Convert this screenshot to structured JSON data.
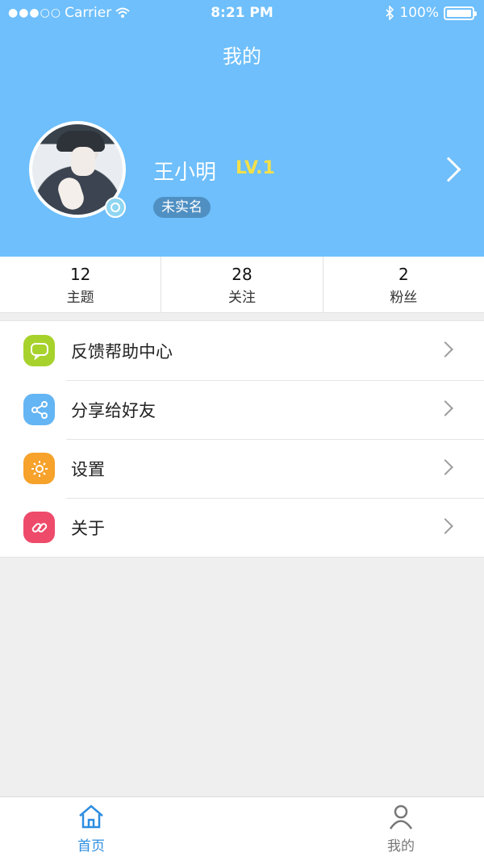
{
  "status_bar": {
    "carrier": "Carrier",
    "time": "8:21 PM",
    "battery": "100%"
  },
  "nav": {
    "title": "我的"
  },
  "profile": {
    "name": "王小明",
    "level": "LV.1",
    "verify_status": "未实名"
  },
  "stats": [
    {
      "value": "12",
      "label": "主题"
    },
    {
      "value": "28",
      "label": "关注"
    },
    {
      "value": "2",
      "label": "粉丝"
    }
  ],
  "menu": [
    {
      "label": "反馈帮助中心",
      "icon": "chat-bubble-icon",
      "color": "#a7d22c"
    },
    {
      "label": "分享给好友",
      "icon": "share-icon",
      "color": "#64b5f4"
    },
    {
      "label": "设置",
      "icon": "gear-icon",
      "color": "#f6a22b"
    },
    {
      "label": "关于",
      "icon": "link-icon",
      "color": "#ee4b6a"
    }
  ],
  "tabbar": {
    "home_label": "首页",
    "mine_label": "我的",
    "active_color": "#2d8de0",
    "inactive_color": "#777777"
  },
  "colors": {
    "header_bg": "#6ebffb",
    "level_color": "#f4e04a"
  }
}
